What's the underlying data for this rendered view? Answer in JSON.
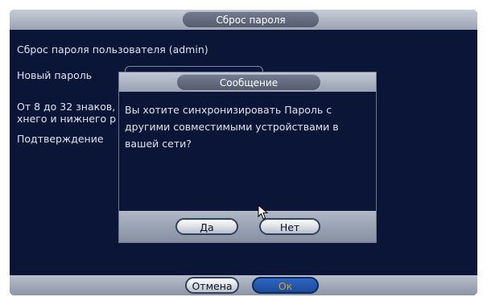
{
  "window": {
    "title": "Сброс пароля",
    "labels": {
      "reset_user": "Сброс пароля пользователя (admin)",
      "new_password": "Новый пароль",
      "hint_line1": "От 8 до 32 знаков,",
      "hint_line2": "хнего и нижнего р",
      "confirm": "Подтверждение"
    },
    "footer": {
      "cancel_label": "Отмена",
      "ok_label": "Ок"
    }
  },
  "dialog": {
    "title": "Сообщение",
    "message": "Вы хотите синхронизировать Пароль с другими совместимыми устройствами в вашей сети?",
    "yes_label": "Да",
    "no_label": "Нет"
  },
  "colors": {
    "background": "#0a1538",
    "titlebar": "#b2b9c6",
    "text": "#dfe4ec",
    "accent_button": "#2a5fb8",
    "accent_text": "#d7a11c"
  }
}
